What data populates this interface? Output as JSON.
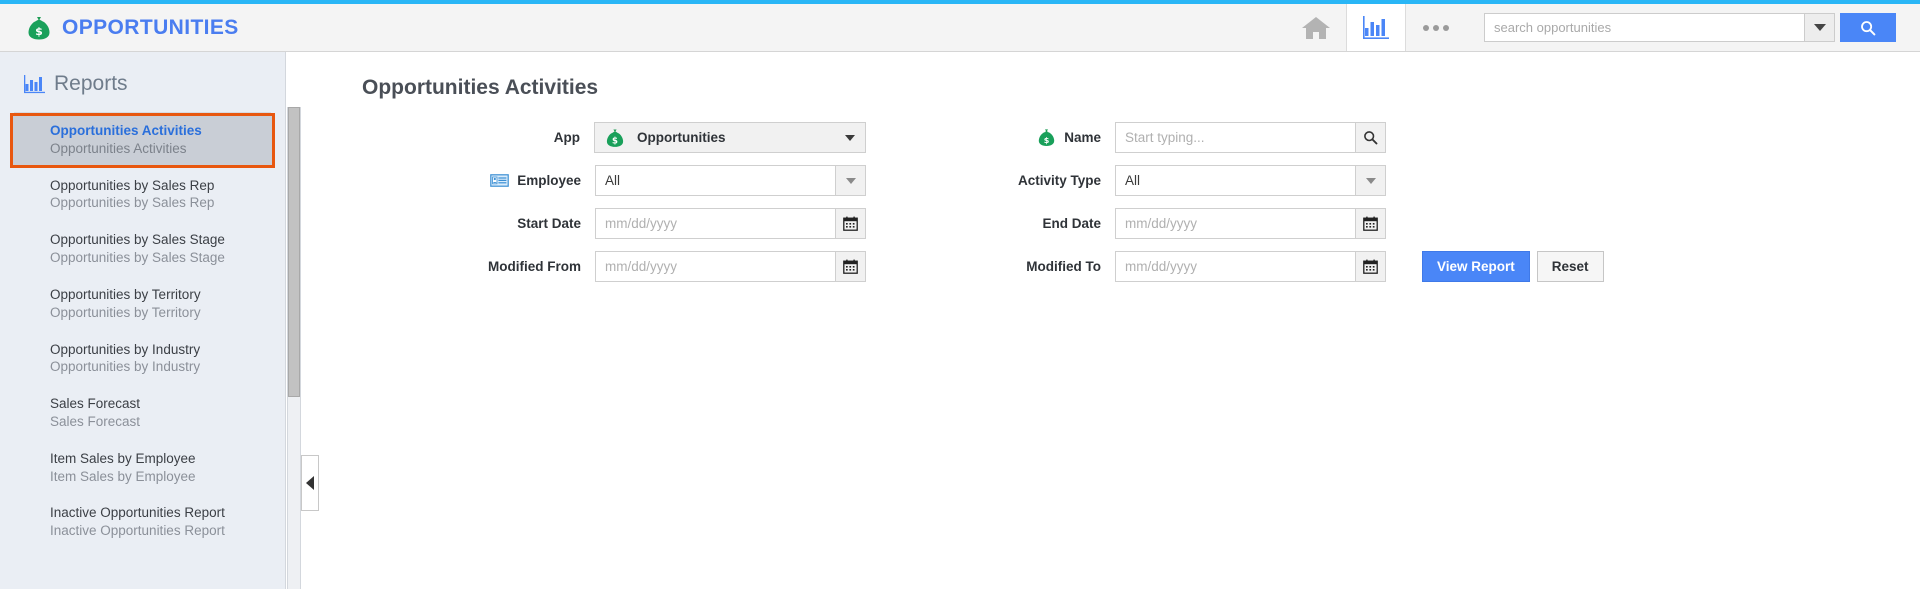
{
  "topbar": {
    "brand_title": "OPPORTUNITIES",
    "brand_icon": "money-bag-icon",
    "home_icon": "home-icon",
    "reports_icon": "bar-chart-icon",
    "more_icon": "ellipsis-icon",
    "search_placeholder": "search opportunities",
    "search_value": "",
    "search_dropdown_icon": "chevron-down-icon",
    "search_button_icon": "search-icon",
    "accent_color": "#4a86f7",
    "top_border_color": "#29b6f6"
  },
  "sidebar": {
    "heading": "Reports",
    "heading_icon": "bar-chart-icon",
    "selected_index": 0,
    "items": [
      {
        "title": "Opportunities Activities",
        "subtitle": "Opportunities Activities"
      },
      {
        "title": "Opportunities by Sales Rep",
        "subtitle": "Opportunities by Sales Rep"
      },
      {
        "title": "Opportunities by Sales Stage",
        "subtitle": "Opportunities by Sales Stage"
      },
      {
        "title": "Opportunities by Territory",
        "subtitle": "Opportunities by Territory"
      },
      {
        "title": "Opportunities by Industry",
        "subtitle": "Opportunities by Industry"
      },
      {
        "title": "Sales Forecast",
        "subtitle": "Sales Forecast"
      },
      {
        "title": "Item Sales by Employee",
        "subtitle": "Item Sales by Employee"
      },
      {
        "title": "Inactive Opportunities Report",
        "subtitle": "Inactive Opportunities Report"
      }
    ],
    "collapse_icon": "chevron-left-icon",
    "highlight_color": "#e8570f"
  },
  "main": {
    "page_title": "Opportunities Activities",
    "fields": {
      "app": {
        "label": "App",
        "value": "Opportunities",
        "icon": "money-bag-icon",
        "caret_icon": "caret-down-icon"
      },
      "name": {
        "label": "Name",
        "icon": "money-bag-icon",
        "placeholder": "Start typing...",
        "value": "",
        "button_icon": "search-icon"
      },
      "employee": {
        "label": "Employee",
        "icon": "id-card-icon",
        "value": "All",
        "caret_icon": "caret-down-icon"
      },
      "activity_type": {
        "label": "Activity Type",
        "value": "All",
        "caret_icon": "caret-down-icon"
      },
      "start_date": {
        "label": "Start Date",
        "placeholder": "mm/dd/yyyy",
        "value": "",
        "button_icon": "calendar-icon"
      },
      "end_date": {
        "label": "End Date",
        "placeholder": "mm/dd/yyyy",
        "value": "",
        "button_icon": "calendar-icon"
      },
      "modified_from": {
        "label": "Modified From",
        "placeholder": "mm/dd/yyyy",
        "value": "",
        "button_icon": "calendar-icon"
      },
      "modified_to": {
        "label": "Modified To",
        "placeholder": "mm/dd/yyyy",
        "value": "",
        "button_icon": "calendar-icon"
      }
    },
    "actions": {
      "view_report": "View Report",
      "reset": "Reset"
    }
  }
}
